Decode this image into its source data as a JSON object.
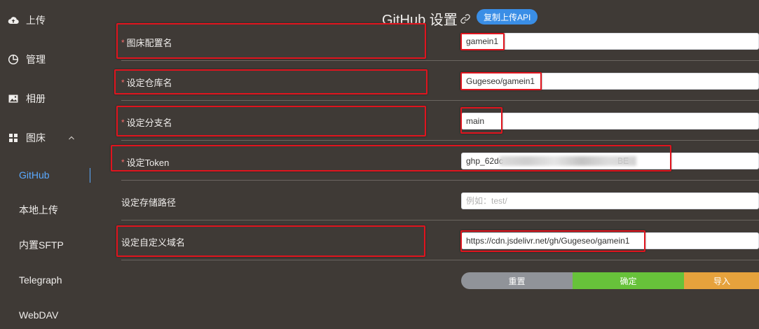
{
  "sidebar": {
    "upload": "上传",
    "manage": "管理",
    "album": "相册",
    "picbed": "图床",
    "subitems": [
      "GitHub",
      "本地上传",
      "内置SFTP",
      "Telegraph",
      "WebDAV"
    ],
    "active_color": "#5aa9ff"
  },
  "header": {
    "title": "GitHub 设置",
    "copy_api_label": "复制上传API"
  },
  "form": {
    "required_mark": "*",
    "fields": [
      {
        "label": "图床配置名",
        "value": "gamein1",
        "placeholder": ""
      },
      {
        "label": "设定仓库名",
        "value": "Gugeseo/gamein1",
        "placeholder": ""
      },
      {
        "label": "设定分支名",
        "value": "main",
        "placeholder": ""
      },
      {
        "label": "设定Token",
        "value": "ghp_62dc                                                 BE",
        "placeholder": ""
      },
      {
        "label": "设定存储路径",
        "value": "",
        "placeholder": "例如：test/"
      },
      {
        "label": "设定自定义域名",
        "value": "https://cdn.jsdelivr.net/gh/Gugeseo/gamein1",
        "placeholder": ""
      }
    ]
  },
  "buttons": {
    "reset": "重置",
    "confirm": "确定",
    "import": "导入"
  },
  "colors": {
    "background": "#3f3a36",
    "highlight_box": "#e0141e",
    "reset": "#909399",
    "confirm": "#67c23a",
    "import": "#e6a23c",
    "primary": "#3a8ee6"
  }
}
